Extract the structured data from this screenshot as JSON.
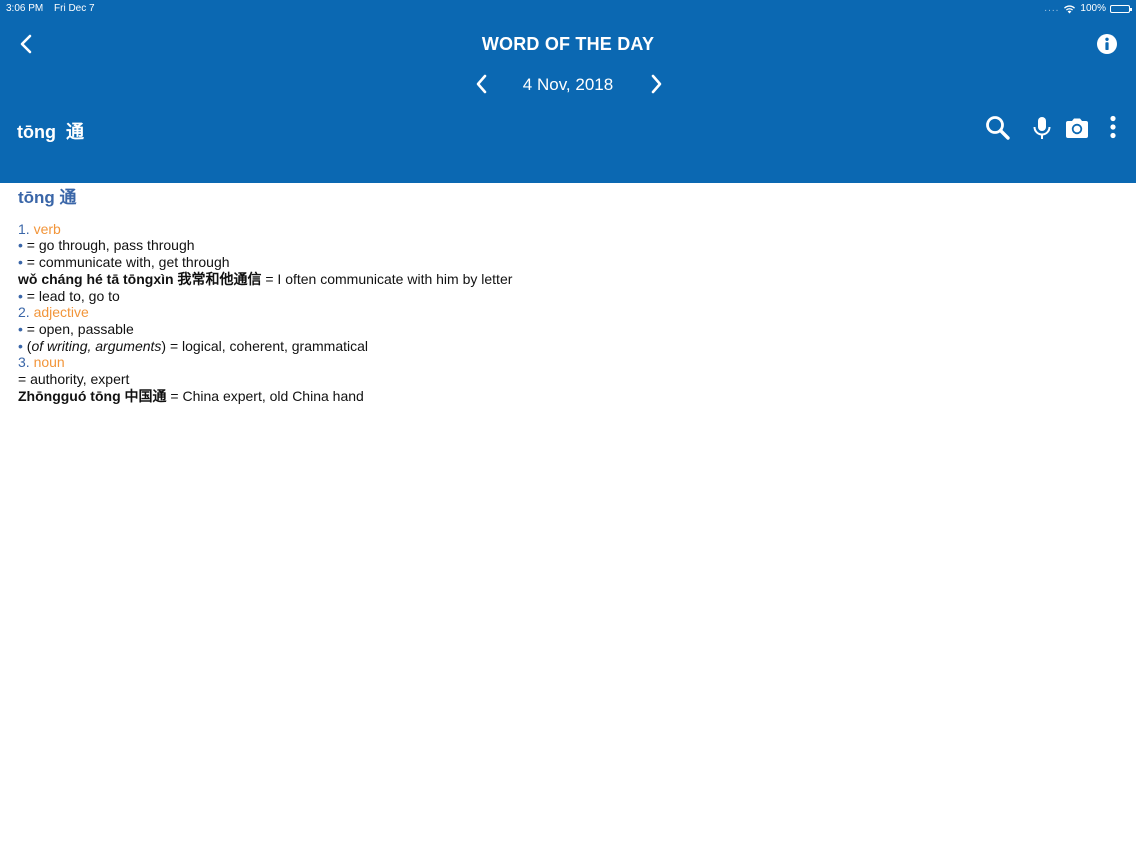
{
  "status": {
    "time": "3:06 PM",
    "date": "Fri Dec 7",
    "signal": "....",
    "battery_text": "100%",
    "battery_level": 1.0
  },
  "header": {
    "title": "WORD OF THE DAY",
    "date": "4 Nov, 2018",
    "word_pinyin": "tōng",
    "word_hanzi": "通",
    "color": "#0b68b2"
  },
  "icons": {
    "back": "chevron-left-icon",
    "info": "info-icon",
    "prev": "chevron-left-icon",
    "next": "chevron-right-icon",
    "search": "search-icon",
    "mic": "microphone-icon",
    "camera": "camera-icon",
    "more": "more-vertical-icon"
  },
  "entry": {
    "headword": "tōng 通",
    "senses": [
      {
        "num": "1.",
        "pos": "verb",
        "lines": [
          {
            "bullet": "•",
            "text": "= go through, pass through"
          },
          {
            "bullet": "•",
            "text": "= communicate with, get through"
          },
          {
            "example": "wǒ cháng hé tā tōngxìn 我常和他通信",
            "translation": " = I often communicate with him by letter"
          },
          {
            "bullet": "•",
            "text": "= lead to, go to"
          }
        ]
      },
      {
        "num": "2.",
        "pos": "adjective",
        "lines": [
          {
            "bullet": "•",
            "text": "= open, passable"
          },
          {
            "bullet": "•",
            "prefix": " (",
            "italic": "of writing, arguments",
            "text": ") = logical, coherent, grammatical"
          }
        ]
      },
      {
        "num": "3.",
        "pos": "noun",
        "lines": [
          {
            "text": "= authority, expert"
          },
          {
            "example": "Zhōngguó tōng 中国通",
            "translation": " = China expert, old China hand"
          }
        ]
      }
    ]
  }
}
